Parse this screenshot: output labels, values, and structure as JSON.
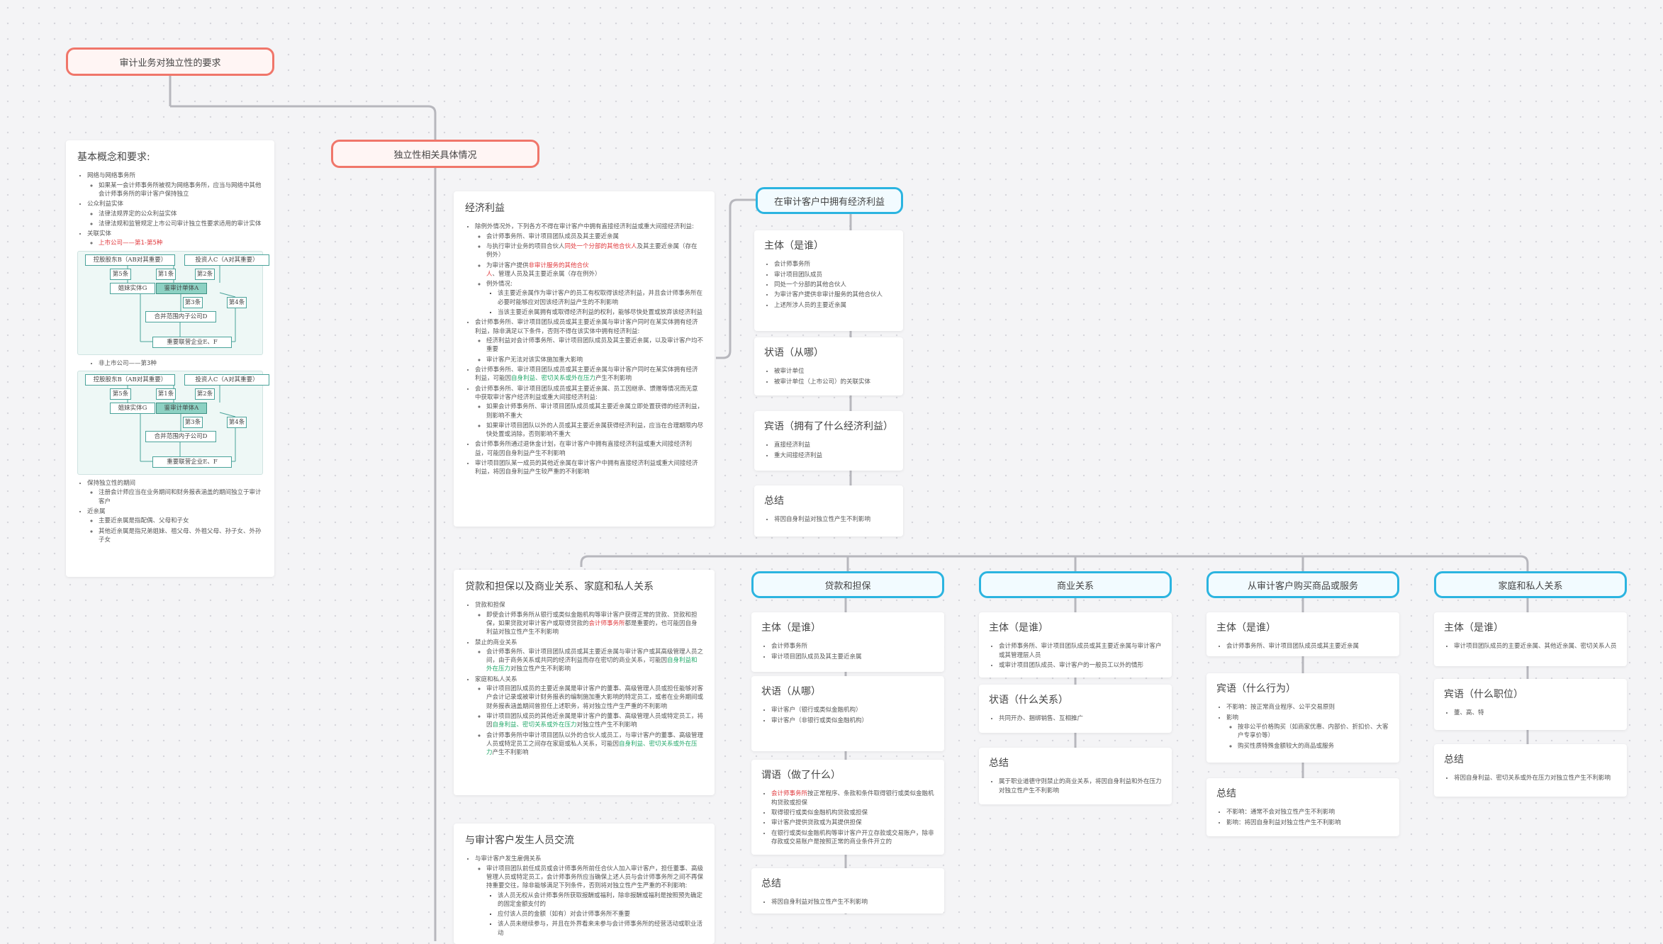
{
  "root": {
    "title": "审计业务对独立性的要求"
  },
  "branch": {
    "title": "独立性相关具体情况"
  },
  "basics": {
    "title": "基本概念和要求:",
    "items": [
      {
        "text": "网络与网络事务所",
        "sub": [
          "如果某一会计师事务所被视为网络事务所，应当与网络中其他会计师事务所的审计客户保持独立"
        ]
      },
      {
        "text": "公众利益实体",
        "sub": [
          "法律法规界定的公众利益实体",
          "法律法规和监管规定上市公司审计独立性要求适用的审计实体"
        ]
      },
      {
        "text": "关联实体",
        "sub_rich": [
          {
            "pre": "",
            "em": "上市公司——第1-第5种",
            "post": ""
          }
        ]
      }
    ],
    "chart1_caption": "",
    "nonlisted": "非上市公司——第3种",
    "items2": [
      {
        "text": "保持独立性的期间",
        "sub": [
          "注册会计师应当在业务期间和财务报表涵盖的期间独立于审计客户"
        ]
      },
      {
        "text": "近亲属",
        "sub": [
          "主要近亲属是指配偶、父母和子女",
          "其他近亲属是指兄弟姐妹、祖父母、外祖父母、孙子女、外孙子女"
        ]
      }
    ]
  },
  "org_chart": {
    "nodes": {
      "top_left": "控股股东B（AB对其重要）",
      "top_right": "投资人C（A对其重要）",
      "n5": "第5条",
      "n1": "第1条",
      "n2": "第2条",
      "sister": "姐妹实体G",
      "client": "鉴审计单体A",
      "n3": "第3条",
      "n4": "第4条",
      "sub": "合并范围内子公司D",
      "assoc": "重要联营企业E、F"
    }
  },
  "economic": {
    "title": "经济利益",
    "items": [
      {
        "text": "除例外情况外，下列各方不得在审计客户中拥有直接经济利益或重大间接经济利益:",
        "sub": [
          {
            "parts": [
              [
                "n",
                "会计师事务所、审计项目团队成员及其主要近亲属"
              ]
            ]
          },
          {
            "parts": [
              [
                "n",
                "与执行审计业务的项目合伙人"
              ],
              [
                "h",
                "同处一个分部的其他合伙人"
              ],
              [
                "n",
                "及其主要近亲属（存在例外）"
              ]
            ]
          },
          {
            "parts": [
              [
                "n",
                "为审计客户提供"
              ],
              [
                "h",
                "非审计服务的其他合伙人"
              ],
              [
                "n",
                "、管理人员及其主要近亲属（存在例外）"
              ]
            ]
          },
          {
            "parts": [
              [
                "n",
                "例外情况:"
              ]
            ],
            "sub": [
              "该主要近亲属作为审计客户的员工有权取得该经济利益，并且会计师事务所在必要时能够应对因该经济利益产生的不利影响",
              "当该主要近亲属拥有或取得经济利益的权利，能够尽快处置或放弃该经济利益"
            ]
          }
        ]
      },
      {
        "text": "会计师事务所、审计项目团队成员或其主要近亲属与审计客户同时在某实体拥有经济利益，除非满足以下条件，否则不得在该实体中拥有经济利益:",
        "sub": [
          {
            "parts": [
              [
                "n",
                "经济利益对会计师事务所、审计项目团队成员及其主要近亲属，以及审计客户均不重要"
              ]
            ]
          },
          {
            "parts": [
              [
                "n",
                "审计客户无法对该实体施加重大影响"
              ]
            ]
          }
        ]
      },
      {
        "rich": [
          [
            "n",
            "会计师事务所、审计项目团队成员或其主要近亲属与审计客户同时在某实体拥有经济利益，可能因"
          ],
          [
            "g",
            "自身利益、密切关系或外在压力"
          ],
          [
            "n",
            "产生不利影响"
          ]
        ]
      },
      {
        "text": "会计师事务所、审计项目团队成员或其主要近亲属、员工因继承、馈赠等情况而无意中获取审计客户经济利益或重大间接经济利益:",
        "sub": [
          {
            "parts": [
              [
                "n",
                "如果会计师事务所、审计项目团队成员或其主要近亲属立即处置获得的经济利益，则影响不重大"
              ]
            ]
          },
          {
            "parts": [
              [
                "n",
                "如果审计项目团队以外的人员或其主要近亲属获得经济利益，应当在合理期限内尽快处置或消除，否则影响不重大"
              ]
            ]
          }
        ]
      },
      {
        "text": "会计师事务所通过退休金计划，在审计客户中拥有直接经济利益或重大间接经济利益，可能因自身利益产生不利影响"
      },
      {
        "text": "审计项目团队某一成员的其他近亲属在审计客户中拥有直接经济利益或重大间接经济利益，将因自身利益产生较严重的不利影响"
      }
    ]
  },
  "eco_topic": {
    "title": "在审计客户中拥有经济利益"
  },
  "eco_cards": [
    {
      "title": "主体（是谁）",
      "items": [
        "会计师事务所",
        "审计项目团队成员",
        "同处一个分部的其他合伙人",
        "为审计客户提供非审计服务的其他合伙人",
        "上述所涉人员的主要近亲属"
      ]
    },
    {
      "title": "状语（从哪）",
      "items": [
        "被审计单位",
        "被审计单位（上市公司）的关联实体"
      ]
    },
    {
      "title": "宾语（拥有了什么经济利益）",
      "items": [
        "直接经济利益",
        "重大间接经济利益"
      ]
    },
    {
      "title": "总结",
      "items": [
        "将因自身利益对独立性产生不利影响"
      ]
    }
  ],
  "loans": {
    "title": "贷款和担保以及商业关系、家庭和私人关系",
    "items": [
      {
        "text": "贷款和担保",
        "sub": [
          {
            "parts": [
              [
                "n",
                "即使会计师事务所从银行或类似金融机构等审计客户获得正常的贷款、贷款和担保，如果贷款对审计客户或取得贷款的"
              ],
              [
                "h",
                "会计师事务所"
              ],
              [
                "n",
                "都是重要的，也可能因自身利益对独立性产生不利影响"
              ]
            ]
          }
        ]
      },
      {
        "text": "禁止的商业关系",
        "sub": [
          {
            "parts": [
              [
                "n",
                "会计师事务所、审计项目团队成员或其主要近亲属与审计客户或其高级管理人员之间，由于商务关系或共同的经济利益而存在密切的商业关系，可能因"
              ],
              [
                "g",
                "自身利益和外在压力"
              ],
              [
                "n",
                "对独立性产生不利影响"
              ]
            ]
          }
        ]
      },
      {
        "text": "家庭和私人关系",
        "sub": [
          {
            "parts": [
              [
                "n",
                "审计项目团队成员的主要近亲属是审计客户的董事、高级管理人员或担任能够对客户会计记录或被审计财务报表的编制施加重大影响的特定员工，或者在业务期间或财务报表涵盖期间曾担任上述职务，将对独立性产生严重的不利影响"
              ]
            ]
          },
          {
            "parts": [
              [
                "n",
                "审计项目团队成员的其他近亲属是审计客户的董事、高级管理人员或特定员工，将因"
              ],
              [
                "g",
                "自身利益、密切关系或外在压力"
              ],
              [
                "n",
                "对独立性产生不利影响"
              ]
            ]
          },
          {
            "parts": [
              [
                "n",
                "会计师事务所中审计项目团队以外的合伙人或员工，与审计客户的董事、高级管理人员或特定员工之间存在家庭或私人关系，可能因"
              ],
              [
                "g",
                "自身利益、密切关系或外在压力"
              ],
              [
                "n",
                "产生不利影响"
              ]
            ]
          }
        ]
      }
    ]
  },
  "staff": {
    "title": "与审计客户发生人员交流",
    "items": [
      {
        "text": "与审计客户发生雇佣关系",
        "sub": [
          {
            "parts": [
              [
                "n",
                "审计项目团队前任成员或会计师事务所前任合伙人加入审计客户，担任董事、高级管理人员或特定员工，会计师事务所应当确保上述人员与会计师事务所之间不再保持重要交往，除非能够满足下列条件，否则将对独立性产生严重的不利影响:"
              ]
            ],
            "sub": [
              "该人员无权从会计师事务所获取报酬或福利，除非报酬或福利是按照预先确定的固定金额支付的",
              "应付该人员的金额（如有）对会计师事务所不重要",
              "该人员未继续参与，并且在外界看来未参与会计师事务所的经营活动或职业活动"
            ]
          }
        ]
      }
    ]
  },
  "topics": {
    "loan": "贷款和担保",
    "business": "商业关系",
    "purchase": "从审计客户购买商品或服务",
    "family": "家庭和私人关系"
  },
  "loan_cards": [
    {
      "title": "主体（是谁）",
      "items": [
        {
          "t": "会计师事务所"
        },
        {
          "t": "审计项目团队成员及其主要近亲属"
        }
      ]
    },
    {
      "title": "状语（从哪）",
      "items": [
        {
          "t": "审计客户（银行或类似金融机构）"
        },
        {
          "t": "审计客户（非银行或类似金融机构）"
        }
      ]
    },
    {
      "title": "谓语（做了什么）",
      "items": [
        {
          "t": "会计师事务所",
          "red": true,
          "rest": "按正常程序、条款和条件取得银行或类似金融机构贷款或担保"
        },
        {
          "t": "取得银行或类似金融机构贷款或担保"
        },
        {
          "t": "审计客户提供贷款或为其提供担保"
        },
        {
          "t": "在银行或类似金融机构等审计客户开立存款或交易账户，除非存款或交易账户是按照正常的商业条件开立的"
        }
      ]
    },
    {
      "title": "总结",
      "items": [
        {
          "t": "将因自身利益对独立性产生不利影响"
        }
      ]
    }
  ],
  "biz_cards": [
    {
      "title": "主体（是谁）",
      "items": [
        "会计师事务所、审计项目团队成员或其主要近亲属与审计客户或其管理层人员",
        "或审计项目团队成员、审计客户的一般员工以外的情形"
      ]
    },
    {
      "title": "状语（什么关系）",
      "items": [
        "共同开办、捆绑销售、互相推广"
      ]
    },
    {
      "title": "总结",
      "items": [
        "属于职业道德守则禁止的商业关系，将因自身利益和外在压力对独立性产生不利影响"
      ]
    }
  ],
  "purchase_cards": [
    {
      "title": "主体（是谁）",
      "items": [
        {
          "t": "会计师事务所、审计项目团队成员或其主要近亲属"
        }
      ]
    },
    {
      "title": "宾语（什么行为）",
      "items": [
        {
          "t": "不影响：按正常商业程序、公平交易原则"
        },
        {
          "t": "影响",
          "sub": [
            "按非公平价格购买（如商家优惠、内部价、折扣价、大客户专享价等）",
            "购买性质特殊金额较大的商品或服务"
          ]
        }
      ]
    },
    {
      "title": "总结",
      "items": [
        {
          "t": "不影响：通常不会对独立性产生不利影响"
        },
        {
          "t": "影响：将因自身利益对独立性产生不利影响"
        }
      ]
    }
  ],
  "family_cards": [
    {
      "title": "主体（是谁）",
      "items": [
        "审计项目团队成员的主要近亲属、其他近亲属、密切关系人员"
      ]
    },
    {
      "title": "宾语（什么职位）",
      "items": [
        "董、高、特"
      ]
    },
    {
      "title": "总结",
      "items": [
        "将因自身利益、密切关系或外在压力对独立性产生不利影响"
      ]
    }
  ],
  "colors": {
    "root_border": "#f0766a",
    "topic_border": "#2bb4e0",
    "connector": "#b7b7bd",
    "highlight_red": "#e0383c",
    "highlight_green": "#23a86a"
  }
}
